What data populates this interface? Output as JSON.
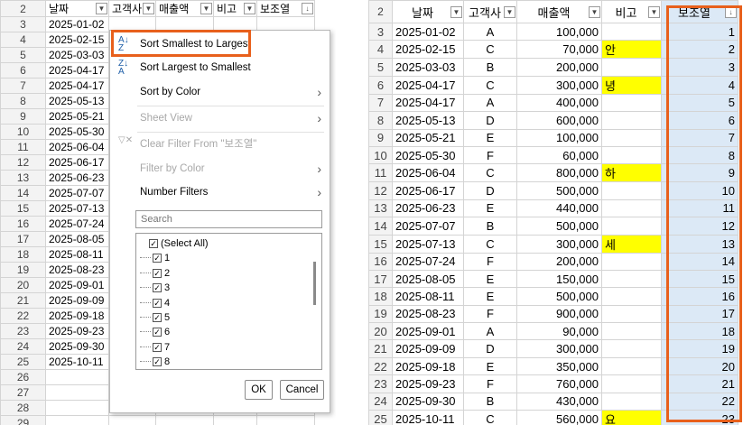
{
  "left": {
    "headers": [
      "날짜",
      "고객사",
      "매출액",
      "비고",
      "보조열"
    ],
    "rows": [
      {
        "row": "2"
      },
      {
        "row": "3",
        "date": "2025-01-02"
      },
      {
        "row": "4",
        "date": "2025-02-15"
      },
      {
        "row": "5",
        "date": "2025-03-03"
      },
      {
        "row": "6",
        "date": "2025-04-17"
      },
      {
        "row": "7",
        "date": "2025-04-17"
      },
      {
        "row": "8",
        "date": "2025-05-13"
      },
      {
        "row": "9",
        "date": "2025-05-21"
      },
      {
        "row": "10",
        "date": "2025-05-30"
      },
      {
        "row": "11",
        "date": "2025-06-04"
      },
      {
        "row": "12",
        "date": "2025-06-17"
      },
      {
        "row": "13",
        "date": "2025-06-23"
      },
      {
        "row": "14",
        "date": "2025-07-07"
      },
      {
        "row": "15",
        "date": "2025-07-13"
      },
      {
        "row": "16",
        "date": "2025-07-24"
      },
      {
        "row": "17",
        "date": "2025-08-05"
      },
      {
        "row": "18",
        "date": "2025-08-11"
      },
      {
        "row": "19",
        "date": "2025-08-23"
      },
      {
        "row": "20",
        "date": "2025-09-01"
      },
      {
        "row": "21",
        "date": "2025-09-09"
      },
      {
        "row": "22",
        "date": "2025-09-18"
      },
      {
        "row": "23",
        "date": "2025-09-23"
      },
      {
        "row": "24",
        "date": "2025-09-30"
      },
      {
        "row": "25",
        "date": "2025-10-11"
      },
      {
        "row": "26"
      },
      {
        "row": "27"
      },
      {
        "row": "28"
      },
      {
        "row": "29"
      }
    ]
  },
  "menu": {
    "sort_asc": "Sort Smallest to Largest",
    "sort_desc": "Sort Largest to Smallest",
    "sort_color": "Sort by Color",
    "sheet_view": "Sheet View",
    "clear_filter": "Clear Filter From \"보조열\"",
    "filter_color": "Filter by Color",
    "number_filters": "Number Filters",
    "search_placeholder": "Search",
    "items": [
      "(Select All)",
      "1",
      "2",
      "3",
      "4",
      "5",
      "6",
      "7",
      "8"
    ],
    "ok": "OK",
    "cancel": "Cancel"
  },
  "right": {
    "header_row": "2",
    "headers": [
      "날짜",
      "고객사",
      "매출액",
      "비고",
      "보조열"
    ],
    "rows": [
      {
        "row": "3",
        "date": "2025-01-02",
        "client": "A",
        "sales": "100,000",
        "note": "",
        "aux": "1"
      },
      {
        "row": "4",
        "date": "2025-02-15",
        "client": "C",
        "sales": "70,000",
        "note": "안",
        "aux": "2"
      },
      {
        "row": "5",
        "date": "2025-03-03",
        "client": "B",
        "sales": "200,000",
        "note": "",
        "aux": "3"
      },
      {
        "row": "6",
        "date": "2025-04-17",
        "client": "C",
        "sales": "300,000",
        "note": "녕",
        "aux": "4"
      },
      {
        "row": "7",
        "date": "2025-04-17",
        "client": "A",
        "sales": "400,000",
        "note": "",
        "aux": "5"
      },
      {
        "row": "8",
        "date": "2025-05-13",
        "client": "D",
        "sales": "600,000",
        "note": "",
        "aux": "6"
      },
      {
        "row": "9",
        "date": "2025-05-21",
        "client": "E",
        "sales": "100,000",
        "note": "",
        "aux": "7"
      },
      {
        "row": "10",
        "date": "2025-05-30",
        "client": "F",
        "sales": "60,000",
        "note": "",
        "aux": "8"
      },
      {
        "row": "11",
        "date": "2025-06-04",
        "client": "C",
        "sales": "800,000",
        "note": "하",
        "aux": "9"
      },
      {
        "row": "12",
        "date": "2025-06-17",
        "client": "D",
        "sales": "500,000",
        "note": "",
        "aux": "10"
      },
      {
        "row": "13",
        "date": "2025-06-23",
        "client": "E",
        "sales": "440,000",
        "note": "",
        "aux": "11"
      },
      {
        "row": "14",
        "date": "2025-07-07",
        "client": "B",
        "sales": "500,000",
        "note": "",
        "aux": "12"
      },
      {
        "row": "15",
        "date": "2025-07-13",
        "client": "C",
        "sales": "300,000",
        "note": "세",
        "aux": "13"
      },
      {
        "row": "16",
        "date": "2025-07-24",
        "client": "F",
        "sales": "200,000",
        "note": "",
        "aux": "14"
      },
      {
        "row": "17",
        "date": "2025-08-05",
        "client": "E",
        "sales": "150,000",
        "note": "",
        "aux": "15"
      },
      {
        "row": "18",
        "date": "2025-08-11",
        "client": "E",
        "sales": "500,000",
        "note": "",
        "aux": "16"
      },
      {
        "row": "19",
        "date": "2025-08-23",
        "client": "F",
        "sales": "900,000",
        "note": "",
        "aux": "17"
      },
      {
        "row": "20",
        "date": "2025-09-01",
        "client": "A",
        "sales": "90,000",
        "note": "",
        "aux": "18"
      },
      {
        "row": "21",
        "date": "2025-09-09",
        "client": "D",
        "sales": "300,000",
        "note": "",
        "aux": "19"
      },
      {
        "row": "22",
        "date": "2025-09-18",
        "client": "E",
        "sales": "350,000",
        "note": "",
        "aux": "20"
      },
      {
        "row": "23",
        "date": "2025-09-23",
        "client": "F",
        "sales": "760,000",
        "note": "",
        "aux": "21"
      },
      {
        "row": "24",
        "date": "2025-09-30",
        "client": "B",
        "sales": "430,000",
        "note": "",
        "aux": "22"
      },
      {
        "row": "25",
        "date": "2025-10-11",
        "client": "C",
        "sales": "560,000",
        "note": "요",
        "aux": "23"
      }
    ]
  },
  "colors": {
    "highlight_orange": "#e8601c",
    "note_yellow": "#ffff00",
    "sorted_column_blue": "#dce9f6"
  }
}
